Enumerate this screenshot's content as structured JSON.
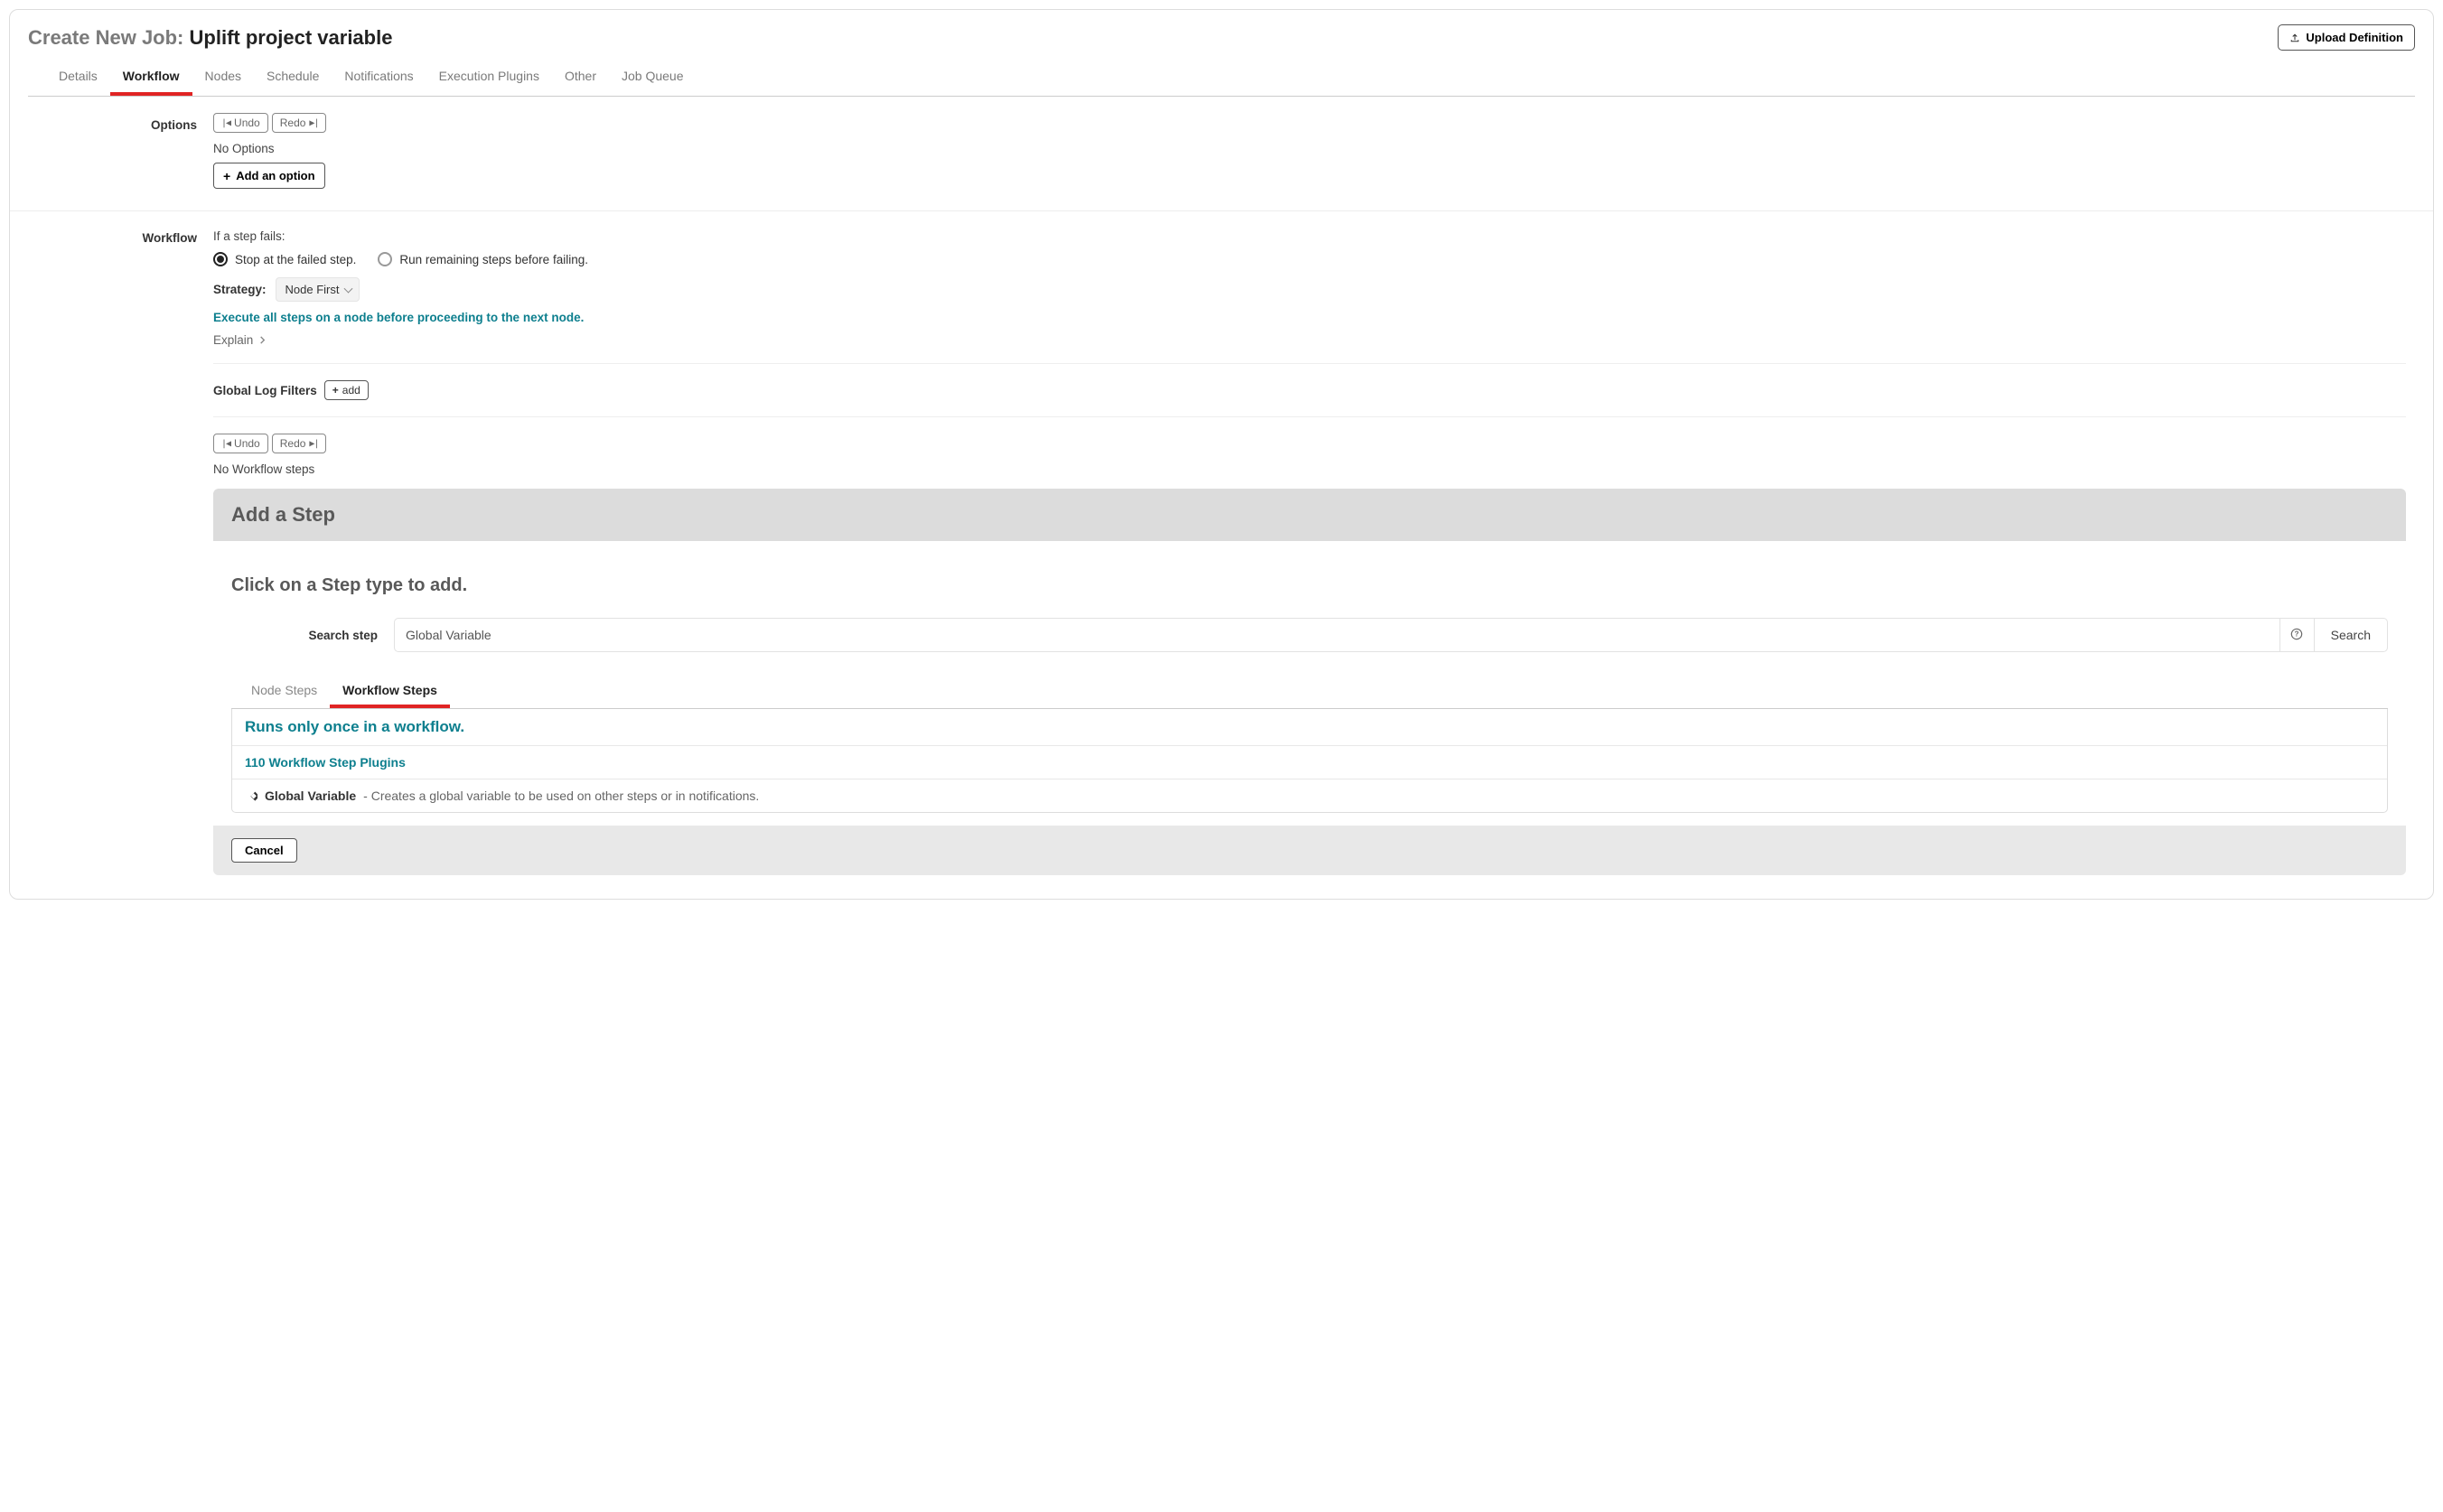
{
  "header": {
    "title_prefix": "Create New Job:",
    "job_name": "Uplift project variable",
    "upload_label": "Upload Definition"
  },
  "tabs": [
    {
      "label": "Details",
      "active": false
    },
    {
      "label": "Workflow",
      "active": true
    },
    {
      "label": "Nodes",
      "active": false
    },
    {
      "label": "Schedule",
      "active": false
    },
    {
      "label": "Notifications",
      "active": false
    },
    {
      "label": "Execution Plugins",
      "active": false
    },
    {
      "label": "Other",
      "active": false
    },
    {
      "label": "Job Queue",
      "active": false
    }
  ],
  "options": {
    "section_label": "Options",
    "undo_label": "Undo",
    "redo_label": "Redo",
    "empty_text": "No Options",
    "add_label": "Add an option"
  },
  "workflow": {
    "section_label": "Workflow",
    "fail_heading": "If a step fails:",
    "radio_stop": "Stop at the failed step.",
    "radio_run": "Run remaining steps before failing.",
    "strategy_label": "Strategy:",
    "strategy_value": "Node First",
    "strategy_desc": "Execute all steps on a node before proceeding to the next node.",
    "explain_label": "Explain",
    "glf_label": "Global Log Filters",
    "glf_add": "add",
    "undo_label": "Undo",
    "redo_label": "Redo",
    "empty_text": "No Workflow steps"
  },
  "add_step": {
    "panel_title": "Add a Step",
    "instruction": "Click on a Step type to add.",
    "search_label": "Search step",
    "search_value": "Global Variable",
    "search_button": "Search",
    "tabs": [
      {
        "label": "Node Steps",
        "active": false
      },
      {
        "label": "Workflow Steps",
        "active": true
      }
    ],
    "runs_once": "Runs only once in a workflow.",
    "plugin_count_text": "110 Workflow Step Plugins",
    "plugin_name": "Global Variable",
    "plugin_desc": " - Creates a global variable to be used on other steps or in notifications.",
    "cancel_label": "Cancel"
  }
}
